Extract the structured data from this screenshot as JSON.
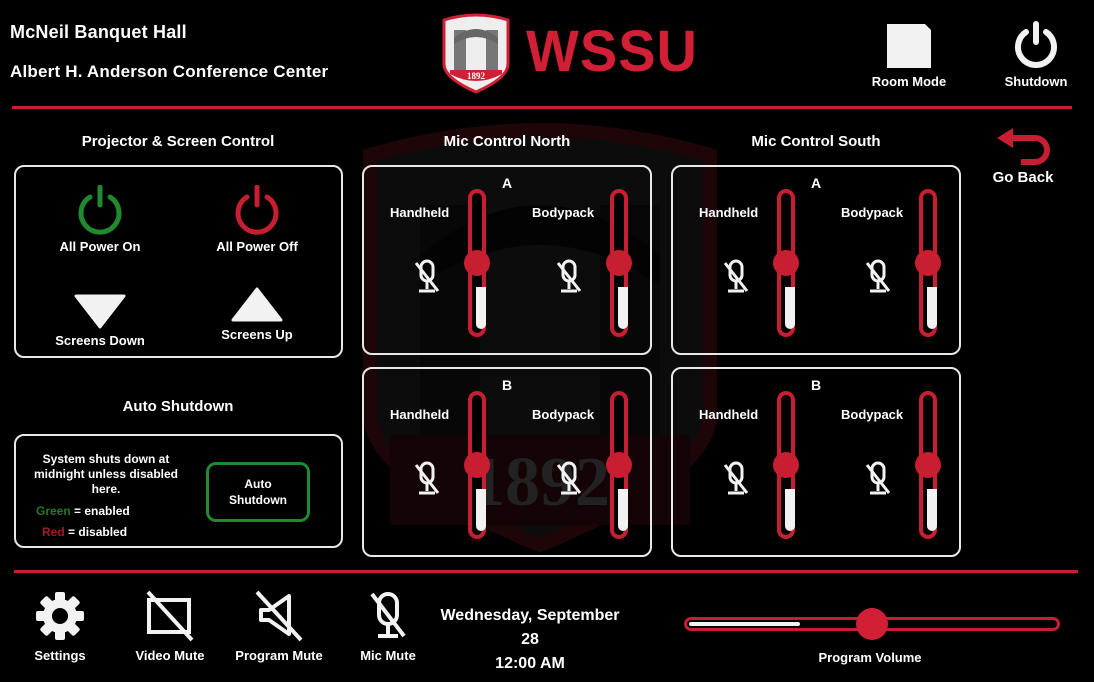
{
  "header": {
    "venue_line1": "McNeil Banquet Hall",
    "venue_line2": "Albert H. Anderson Conference Center",
    "logo_text": "WSSU",
    "logo_year": "1892",
    "room_mode_label": "Room Mode",
    "shutdown_label": "Shutdown"
  },
  "colors": {
    "accent_red": "#c81e32",
    "enabled_green": "#1f8a2e",
    "background": "#000000",
    "text": "#ffffff"
  },
  "projector": {
    "title": "Projector & Screen Control",
    "buttons": [
      {
        "label": "All Power On",
        "icon": "power-icon",
        "color": "#1f8a2e"
      },
      {
        "label": "All Power Off",
        "icon": "power-icon",
        "color": "#c81e32"
      },
      {
        "label": "Screens Down",
        "icon": "triangle-down-icon"
      },
      {
        "label": "Screens Up",
        "icon": "triangle-up-icon"
      }
    ]
  },
  "auto_shutdown": {
    "title": "Auto Shutdown",
    "description": "System shuts down at midnight unless disabled here.",
    "legend_green_word": "Green",
    "legend_green_rest": "= enabled",
    "legend_red_word": "Red",
    "legend_red_rest": "= disabled",
    "button_label_line1": "Auto",
    "button_label_line2": "Shutdown",
    "state": "enabled"
  },
  "mic_north": {
    "title": "Mic Control North",
    "groups": [
      {
        "letter": "A",
        "channels": [
          {
            "label": "Handheld",
            "muted": true,
            "level": 0.5,
            "meter": 0.3
          },
          {
            "label": "Bodypack",
            "muted": true,
            "level": 0.5,
            "meter": 0.3
          }
        ]
      },
      {
        "letter": "B",
        "channels": [
          {
            "label": "Handheld",
            "muted": true,
            "level": 0.5,
            "meter": 0.3
          },
          {
            "label": "Bodypack",
            "muted": true,
            "level": 0.5,
            "meter": 0.3
          }
        ]
      }
    ]
  },
  "mic_south": {
    "title": "Mic Control South",
    "groups": [
      {
        "letter": "A",
        "channels": [
          {
            "label": "Handheld",
            "muted": true,
            "level": 0.5,
            "meter": 0.3
          },
          {
            "label": "Bodypack",
            "muted": true,
            "level": 0.5,
            "meter": 0.3
          }
        ]
      },
      {
        "letter": "B",
        "channels": [
          {
            "label": "Handheld",
            "muted": true,
            "level": 0.5,
            "meter": 0.3
          },
          {
            "label": "Bodypack",
            "muted": true,
            "level": 0.5,
            "meter": 0.3
          }
        ]
      }
    ]
  },
  "go_back_label": "Go Back",
  "footer": {
    "settings_label": "Settings",
    "video_mute_label": "Video Mute",
    "program_mute_label": "Program Mute",
    "mic_mute_label": "Mic Mute",
    "date": "Wednesday, September 28",
    "time": "12:00 AM",
    "program_volume_label": "Program Volume",
    "program_volume_level": 0.5,
    "program_volume_meter": 0.3
  }
}
